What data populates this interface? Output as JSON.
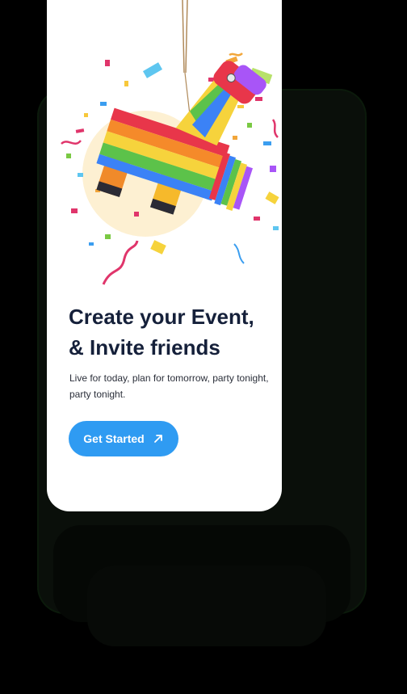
{
  "onboarding": {
    "headline_line1": "Create your Event,",
    "headline_line2": "& Invite friends",
    "subtext": "Live for today, plan for tomorrow, party tonight, party tonight.",
    "cta_label": "Get Started",
    "cta_icon": "arrow-up-right-icon",
    "illustration": "rainbow-pinata-with-confetti"
  },
  "colors": {
    "background": "#000000",
    "card": "#ffffff",
    "headline": "#15203a",
    "cta": "#2f9bf2"
  }
}
